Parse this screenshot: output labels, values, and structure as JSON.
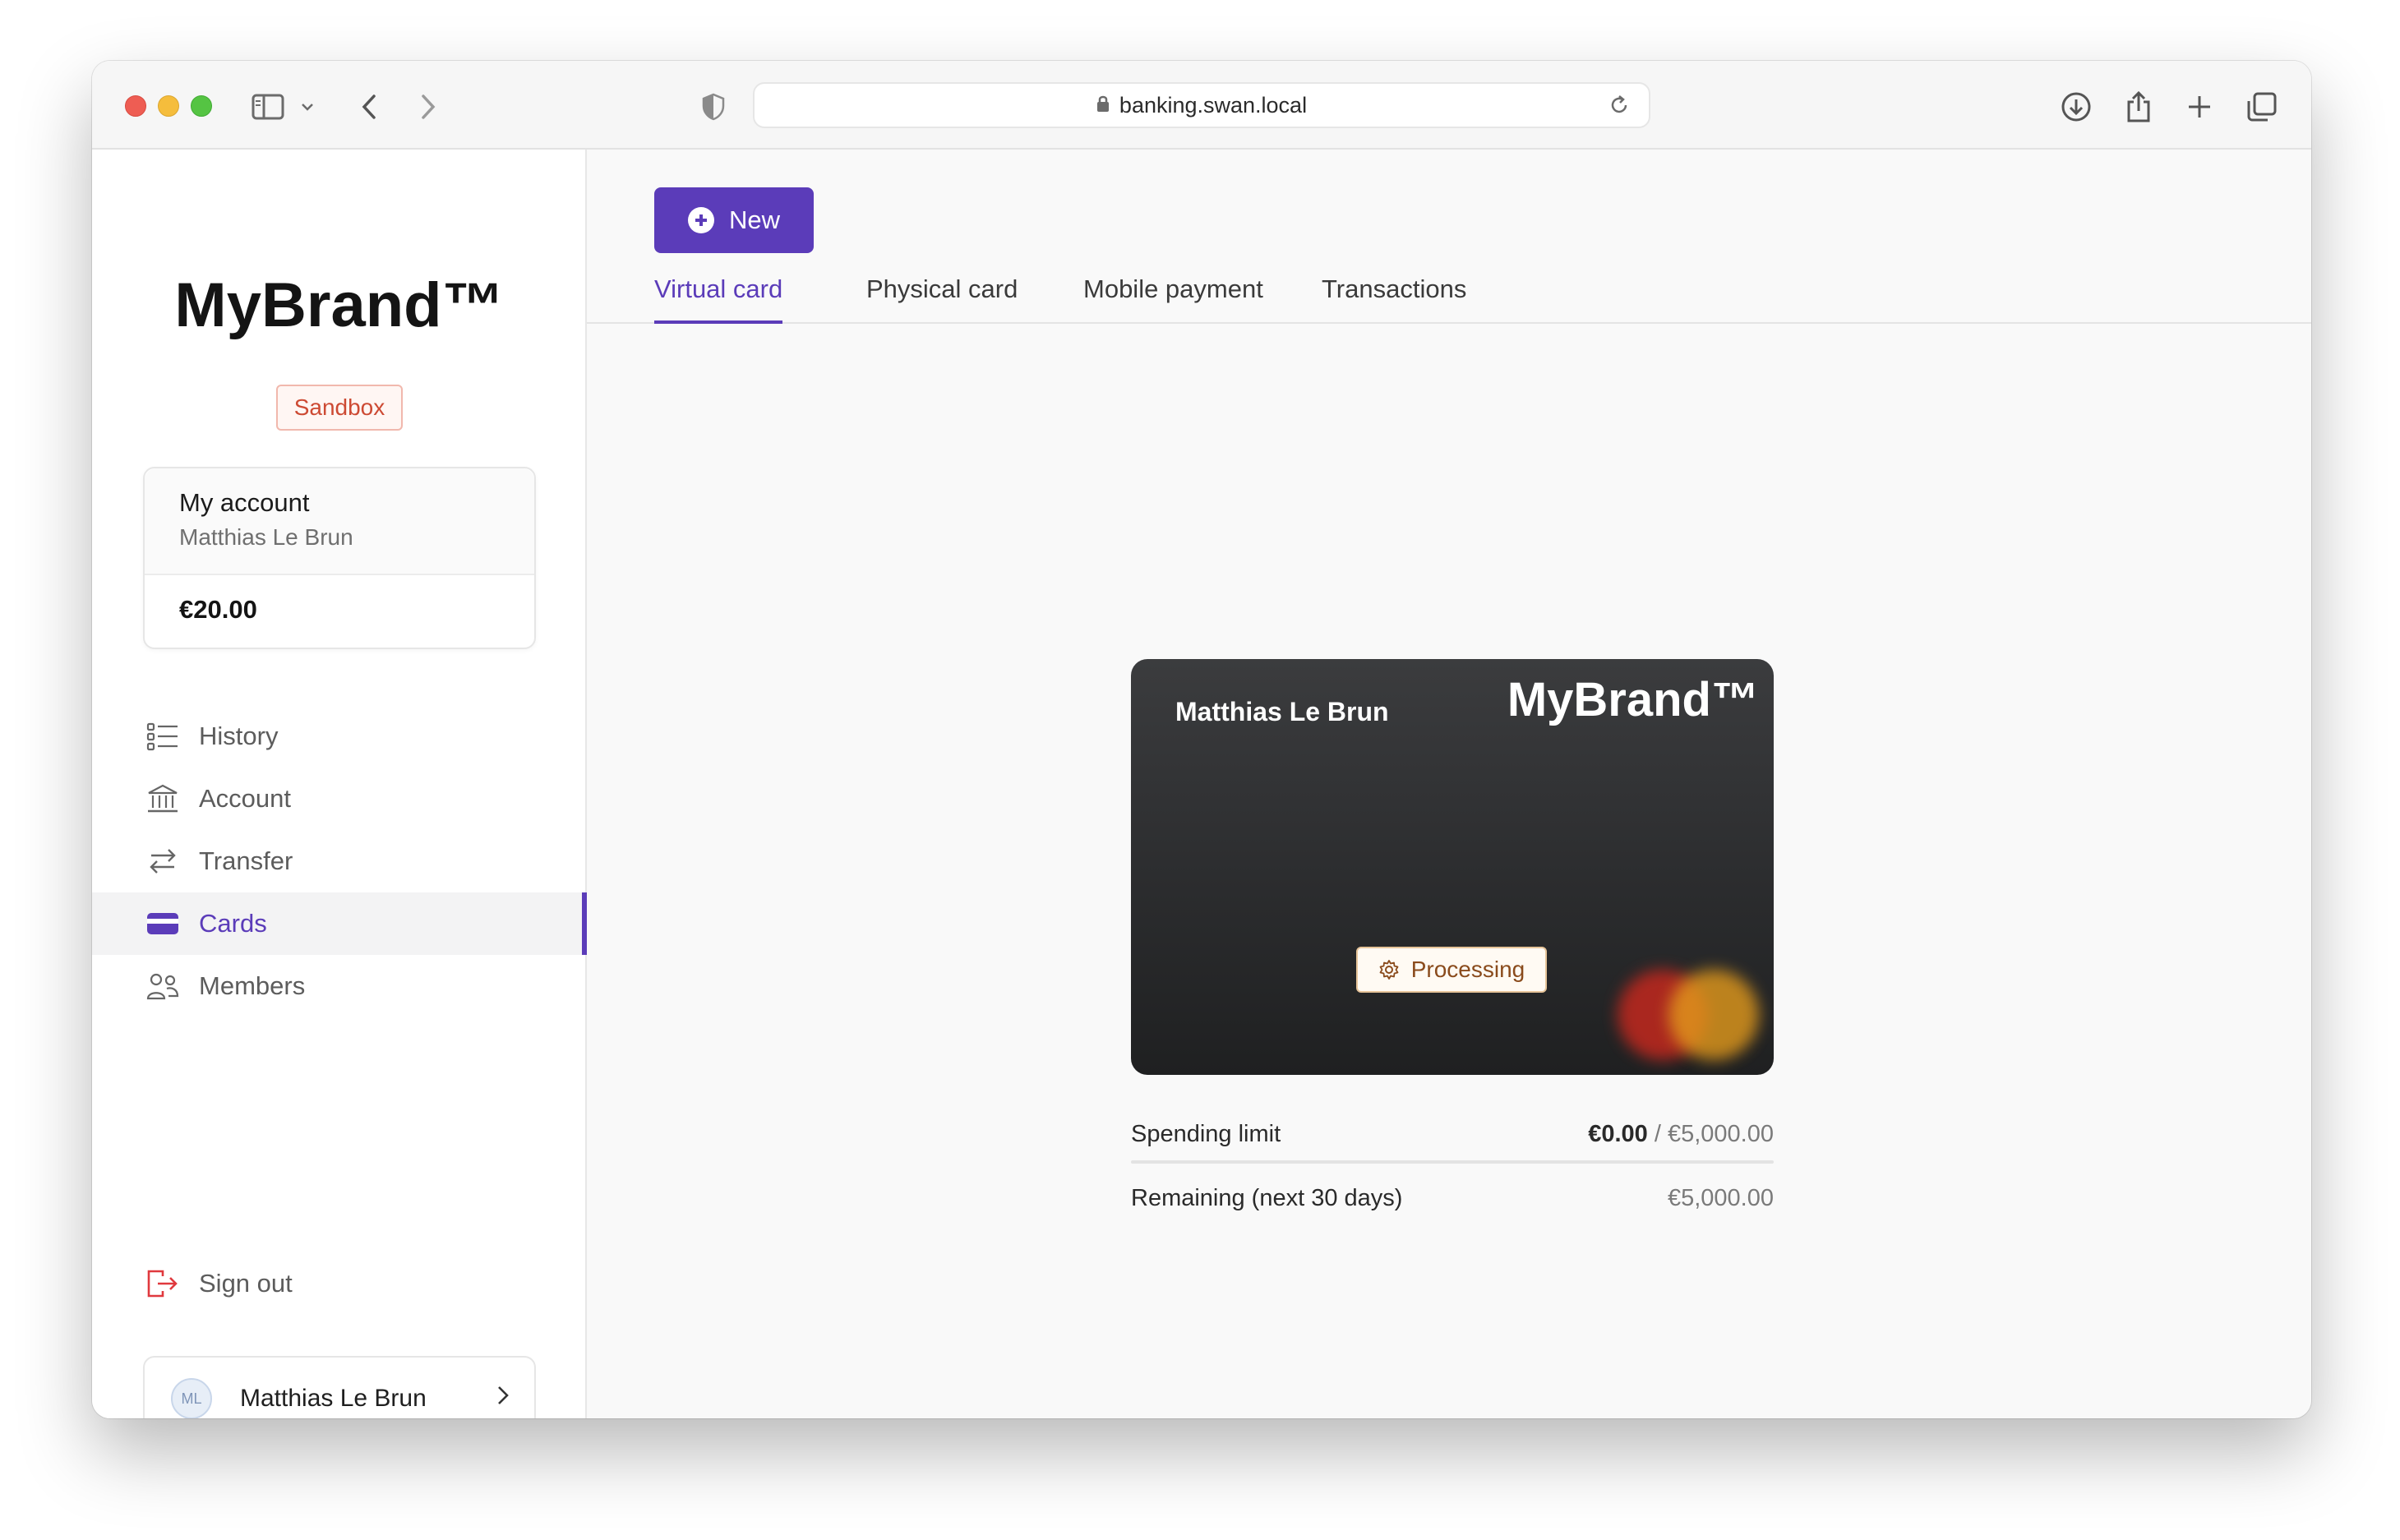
{
  "browser": {
    "url": "banking.swan.local"
  },
  "sidebar": {
    "brand": "MyBrand™",
    "environment_badge": "Sandbox",
    "account": {
      "title": "My account",
      "holder": "Matthias Le Brun",
      "balance": "€20.00"
    },
    "nav": [
      {
        "label": "History",
        "icon": "list-icon"
      },
      {
        "label": "Account",
        "icon": "bank-icon"
      },
      {
        "label": "Transfer",
        "icon": "arrows-icon"
      },
      {
        "label": "Cards",
        "icon": "card-icon",
        "active": true
      },
      {
        "label": "Members",
        "icon": "members-icon"
      }
    ],
    "sign_out": "Sign out",
    "user": {
      "initials": "ML",
      "name": "Matthias Le Brun"
    }
  },
  "main": {
    "new_button": "New",
    "tabs": [
      {
        "label": "Virtual card",
        "active": true
      },
      {
        "label": "Physical card"
      },
      {
        "label": "Mobile payment"
      },
      {
        "label": "Transactions"
      }
    ],
    "card": {
      "holder": "Matthias Le Brun",
      "brand": "MyBrand™",
      "status": "Processing"
    },
    "spending_limit": {
      "label": "Spending limit",
      "spent": "€0.00",
      "separator": "/",
      "limit": "€5,000.00"
    },
    "remaining": {
      "label": "Remaining (next 30 days)",
      "value": "€5,000.00"
    }
  },
  "colors": {
    "accent": "#5b3cb9",
    "sandbox": "#cd4a33",
    "processing": "#8a4b1c"
  }
}
